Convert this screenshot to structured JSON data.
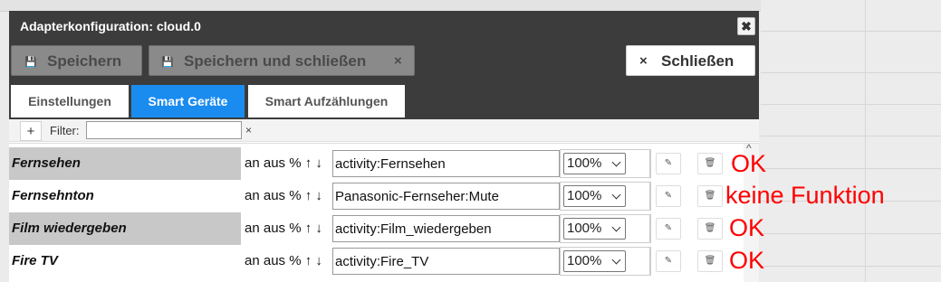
{
  "dialog": {
    "title": "Adapterkonfiguration: cloud.0",
    "close_symbol": "✖"
  },
  "toolbar": {
    "save_label": "Speichern",
    "save_close_label": "Speichern und schließen",
    "save_close_x": "×",
    "close_label": "Schließen",
    "close_x": "×",
    "save_icon": "💾"
  },
  "tabs": [
    {
      "label": "Einstellungen",
      "active": false
    },
    {
      "label": "Smart Geräte",
      "active": true
    },
    {
      "label": "Smart Aufzählungen",
      "active": false
    }
  ],
  "filter": {
    "add_label": "+",
    "label": "Filter:",
    "value": "",
    "clear_symbol": "×"
  },
  "actions_text": {
    "an": "an",
    "aus": "aus",
    "percent": "%",
    "up": "↑",
    "down": "↓"
  },
  "rows": [
    {
      "name": "Fernsehen",
      "smart_name": "activity:Fernsehen",
      "value": "100%",
      "note": "OK",
      "shaded": true
    },
    {
      "name": "Fernsehnton",
      "smart_name": "Panasonic-Fernseher:Mute",
      "value": "100%",
      "note": "keine Funktion",
      "shaded": false
    },
    {
      "name": "Film wiedergeben",
      "smart_name": "activity:Film_wiedergeben",
      "value": "100%",
      "note": "OK",
      "shaded": true
    },
    {
      "name": "Fire TV",
      "smart_name": "activity:Fire_TV",
      "value": "100%",
      "note": "OK",
      "shaded": false
    }
  ],
  "row_icons": {
    "edit": "✎",
    "delete": "🗑"
  },
  "scroll_up": "^",
  "colors": {
    "accent": "#1a8cf0",
    "header": "#3c3c3c",
    "note": "#ff0000"
  }
}
